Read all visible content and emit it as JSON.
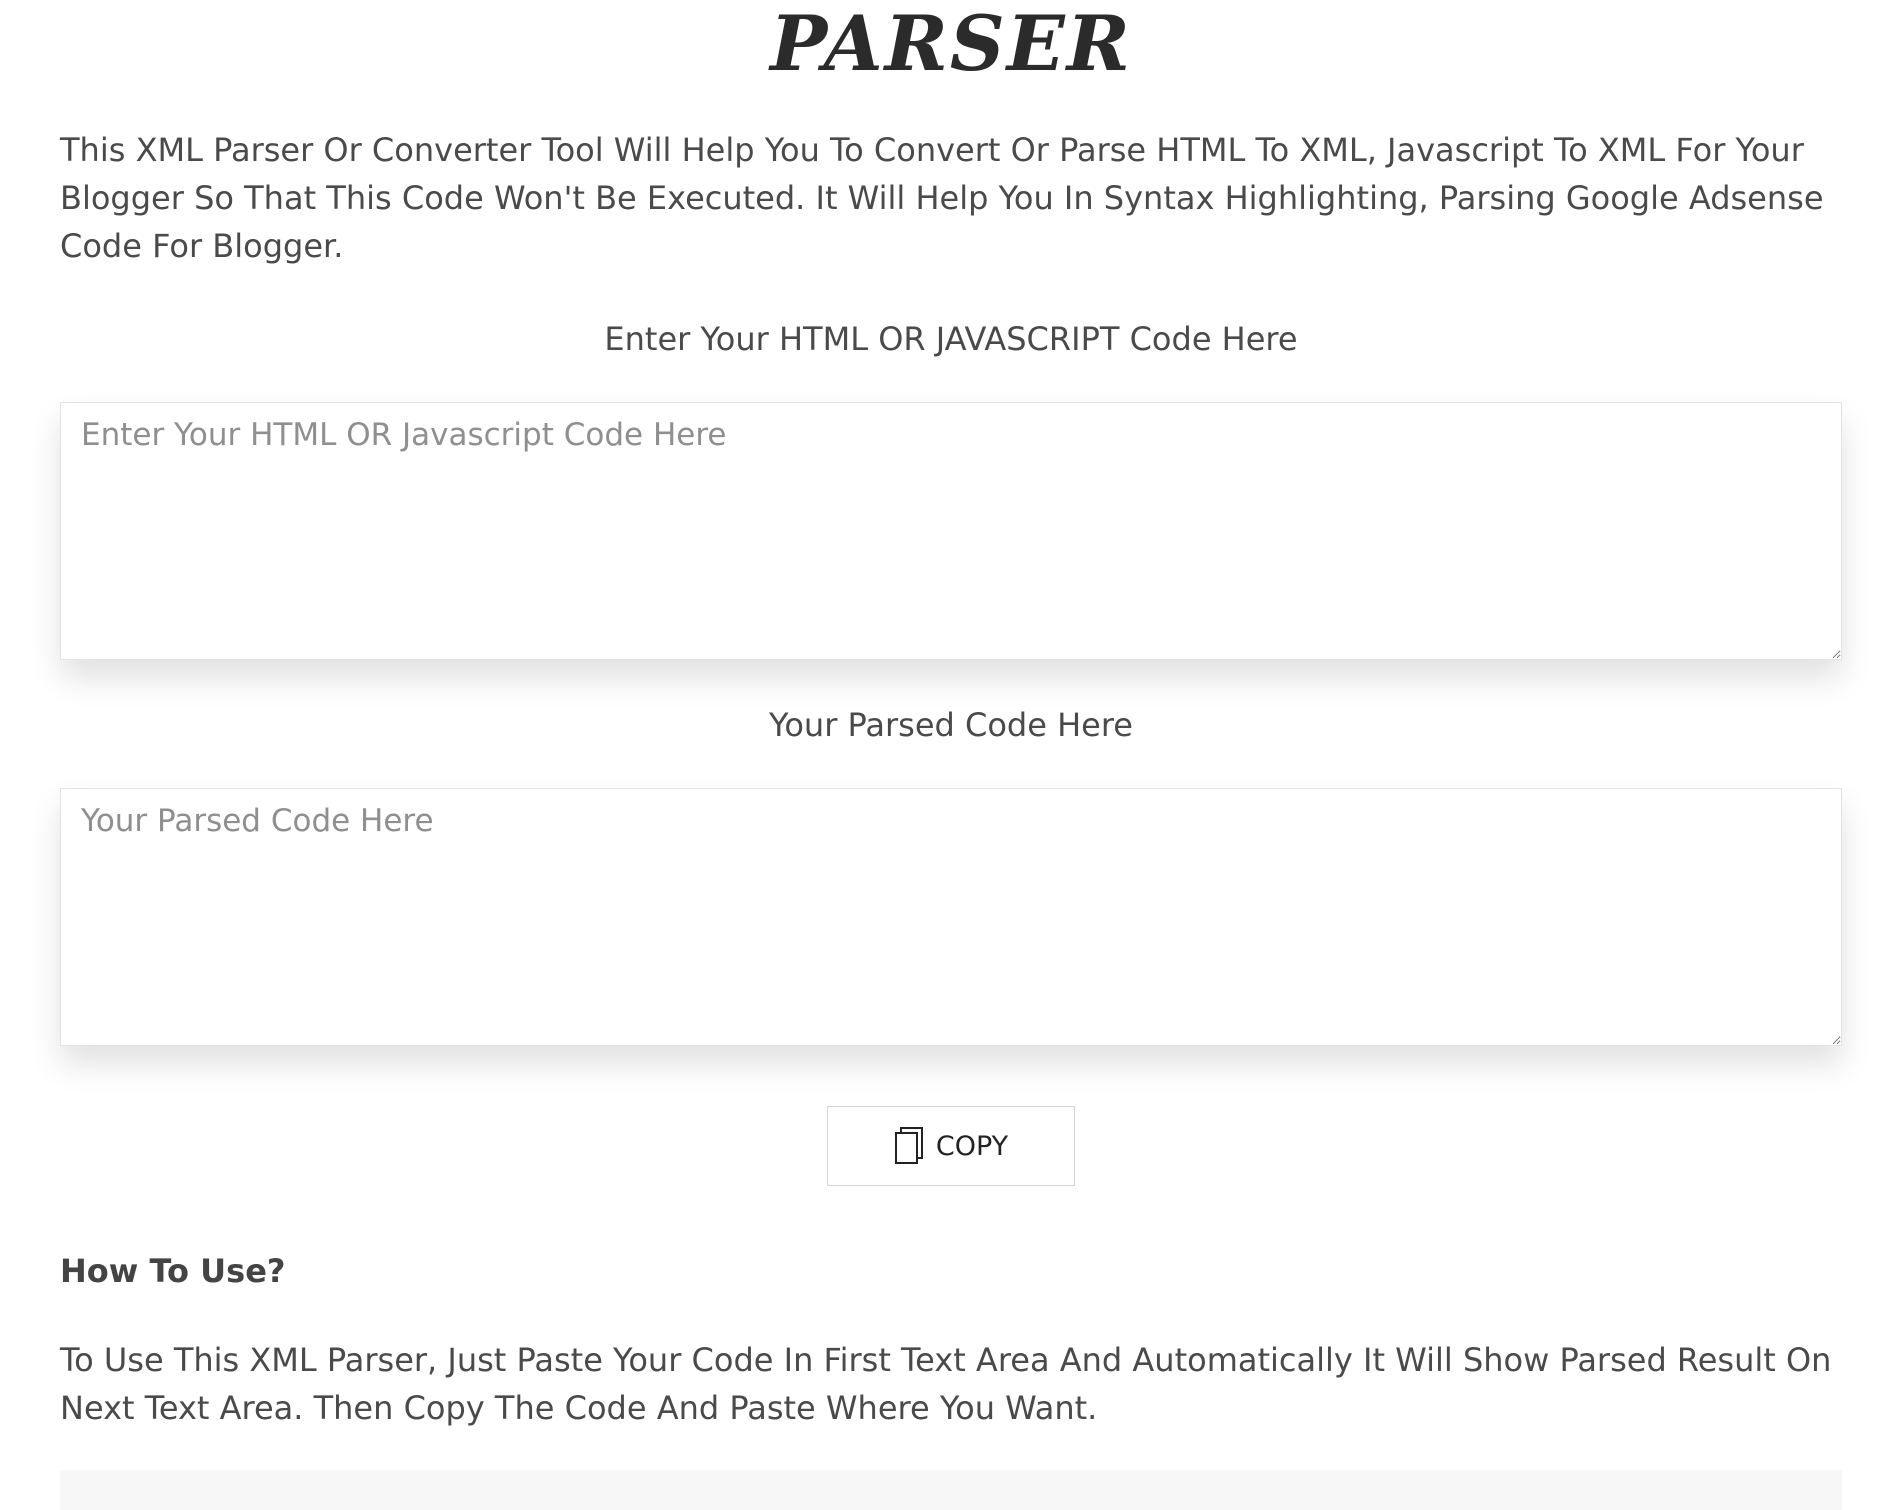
{
  "header": {
    "logo_text": "PARSER"
  },
  "intro": {
    "text": "This XML Parser Or Converter Tool Will Help You To Convert Or Parse HTML To XML, Javascript To XML For Your Blogger So That This Code Won't Be Executed. It Will Help You In Syntax Highlighting, Parsing Google Adsense Code For Blogger."
  },
  "input_section": {
    "label": "Enter Your HTML OR JAVASCRIPT Code Here",
    "placeholder": "Enter Your HTML OR Javascript Code Here",
    "value": ""
  },
  "output_section": {
    "label": "Your Parsed Code Here",
    "placeholder": "Your Parsed Code Here",
    "value": ""
  },
  "copy_button": {
    "label": "COPY",
    "icon": "copy-icon"
  },
  "how_to": {
    "heading": "How To Use?",
    "text": "To Use This XML Parser, Just Paste Your Code In First Text Area And Automatically It Will Show Parsed Result On Next Text Area. Then Copy The Code And Paste Where You Want."
  }
}
